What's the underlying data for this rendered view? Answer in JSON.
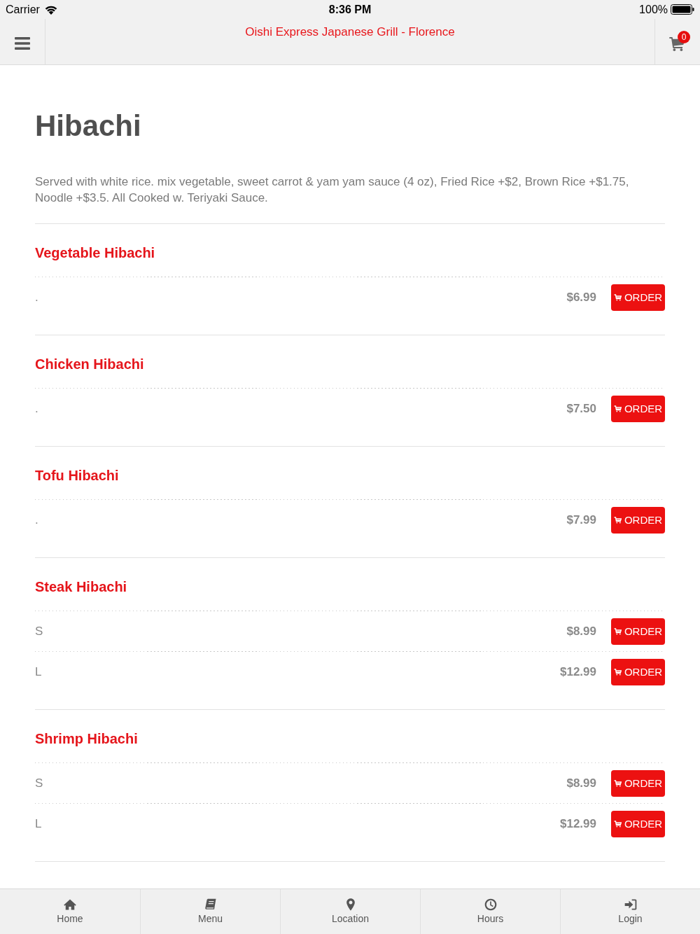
{
  "status_bar": {
    "carrier": "Carrier",
    "time": "8:36 PM",
    "battery": "100%"
  },
  "header": {
    "title": "Oishi Express Japanese Grill - Florence",
    "cart_count": "0"
  },
  "category": {
    "title": "Hibachi",
    "description": "Served with white rice. mix vegetable, sweet carrot & yam yam sauce (4 oz), Fried Rice +$2, Brown Rice +$1.75, Noodle +$3.5. All Cooked w. Teriyaki Sauce."
  },
  "items": [
    {
      "name": "Vegetable Hibachi",
      "options": [
        {
          "label": ".",
          "price": "$6.99",
          "button": "ORDER"
        }
      ]
    },
    {
      "name": "Chicken Hibachi",
      "options": [
        {
          "label": ".",
          "price": "$7.50",
          "button": "ORDER"
        }
      ]
    },
    {
      "name": "Tofu Hibachi",
      "options": [
        {
          "label": ".",
          "price": "$7.99",
          "button": "ORDER"
        }
      ]
    },
    {
      "name": "Steak Hibachi",
      "options": [
        {
          "label": "S",
          "price": "$8.99",
          "button": "ORDER"
        },
        {
          "label": "L",
          "price": "$12.99",
          "button": "ORDER"
        }
      ]
    },
    {
      "name": "Shrimp Hibachi",
      "options": [
        {
          "label": "S",
          "price": "$8.99",
          "button": "ORDER"
        },
        {
          "label": "L",
          "price": "$12.99",
          "button": "ORDER"
        }
      ]
    }
  ],
  "tab_bar": [
    {
      "kind": "home",
      "label": "Home",
      "selected": false
    },
    {
      "kind": "menu",
      "label": "Menu",
      "selected": false
    },
    {
      "kind": "location",
      "label": "Location",
      "selected": false
    },
    {
      "kind": "hours",
      "label": "Hours",
      "selected": false
    },
    {
      "kind": "login",
      "label": "Login",
      "selected": false
    }
  ]
}
